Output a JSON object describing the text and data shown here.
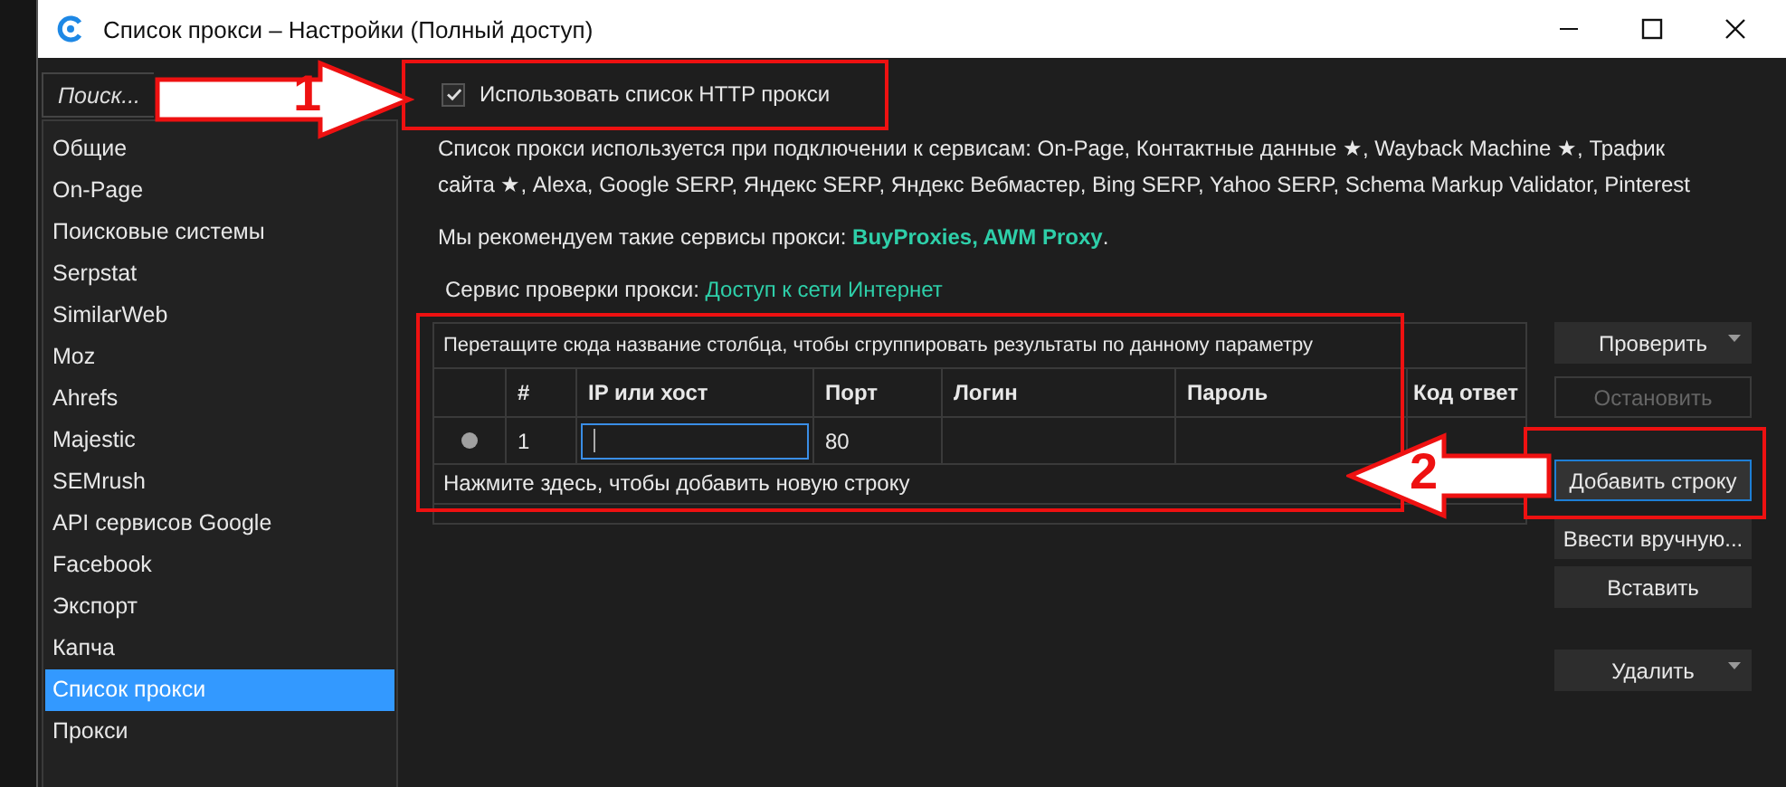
{
  "window": {
    "title": "Список прокси – Настройки (Полный доступ)"
  },
  "sidebar": {
    "search": {
      "placeholder": "Поиск..."
    },
    "items": [
      {
        "label": "Общие",
        "selected": false
      },
      {
        "label": "On-Page",
        "selected": false
      },
      {
        "label": "Поисковые системы",
        "selected": false
      },
      {
        "label": "Serpstat",
        "selected": false
      },
      {
        "label": "SimilarWeb",
        "selected": false
      },
      {
        "label": "Moz",
        "selected": false
      },
      {
        "label": "Ahrefs",
        "selected": false
      },
      {
        "label": "Majestic",
        "selected": false
      },
      {
        "label": "SEMrush",
        "selected": false
      },
      {
        "label": "API сервисов Google",
        "selected": false
      },
      {
        "label": "Facebook",
        "selected": false
      },
      {
        "label": "Экспорт",
        "selected": false
      },
      {
        "label": "Капча",
        "selected": false
      },
      {
        "label": "Список прокси",
        "selected": true
      },
      {
        "label": "Прокси",
        "selected": false
      }
    ]
  },
  "use_proxy": {
    "label": "Использовать список HTTP прокси",
    "checked": true
  },
  "description": "Список прокси используется при подключении к сервисам: On-Page, Контактные данные ★, Wayback Machine ★, Трафик сайта ★, Alexa, Google SERP, Яндекс SERP, Яндекс Вебмастер, Bing SERP, Yahoo SERP, Schema Markup Validator, Pinterest",
  "recommendation": [
    {
      "kind": "text",
      "text": "Мы рекомендуем такие сервисы прокси: "
    },
    {
      "kind": "link",
      "text": "BuyProxies"
    },
    {
      "kind": "link",
      "text": ", "
    },
    {
      "kind": "link",
      "text": "AWM Proxy"
    },
    {
      "kind": "text",
      "text": "."
    }
  ],
  "check_service": {
    "label": "Сервис проверки прокси:",
    "link": "Доступ к сети Интернет"
  },
  "table": {
    "group_hint": "Перетащите сюда название столбца, чтобы сгруппировать результаты по данному параметру",
    "columns": [
      "#",
      "IP или хост",
      "Порт",
      "Логин",
      "Пароль",
      "Код ответ"
    ],
    "rows": [
      {
        "color": "#a0a0a0",
        "cells": [
          {
            "text": "1",
            "editing": false
          },
          {
            "text": "",
            "editing": true
          },
          {
            "text": "80",
            "editing": false
          },
          {
            "text": "",
            "editing": false
          },
          {
            "text": "",
            "editing": false
          },
          {
            "text": "",
            "editing": false
          }
        ]
      }
    ],
    "new_row_hint": "Нажмите здесь, чтобы добавить новую строку"
  },
  "buttons": [
    {
      "label": "Проверить",
      "dropdown": true,
      "disabled": false,
      "focused": false
    },
    {
      "label": "Остановить",
      "dropdown": false,
      "disabled": true,
      "focused": false
    },
    {
      "label": "Добавить строку",
      "dropdown": false,
      "disabled": false,
      "focused": true
    },
    {
      "label": "Ввести вручную...",
      "dropdown": false,
      "disabled": false,
      "focused": false
    },
    {
      "label": "Вставить",
      "dropdown": false,
      "disabled": false,
      "focused": false
    },
    {
      "label": "Удалить",
      "dropdown": true,
      "disabled": false,
      "focused": false
    }
  ],
  "annotations": [
    {
      "label": "1"
    },
    {
      "label": "2"
    }
  ]
}
